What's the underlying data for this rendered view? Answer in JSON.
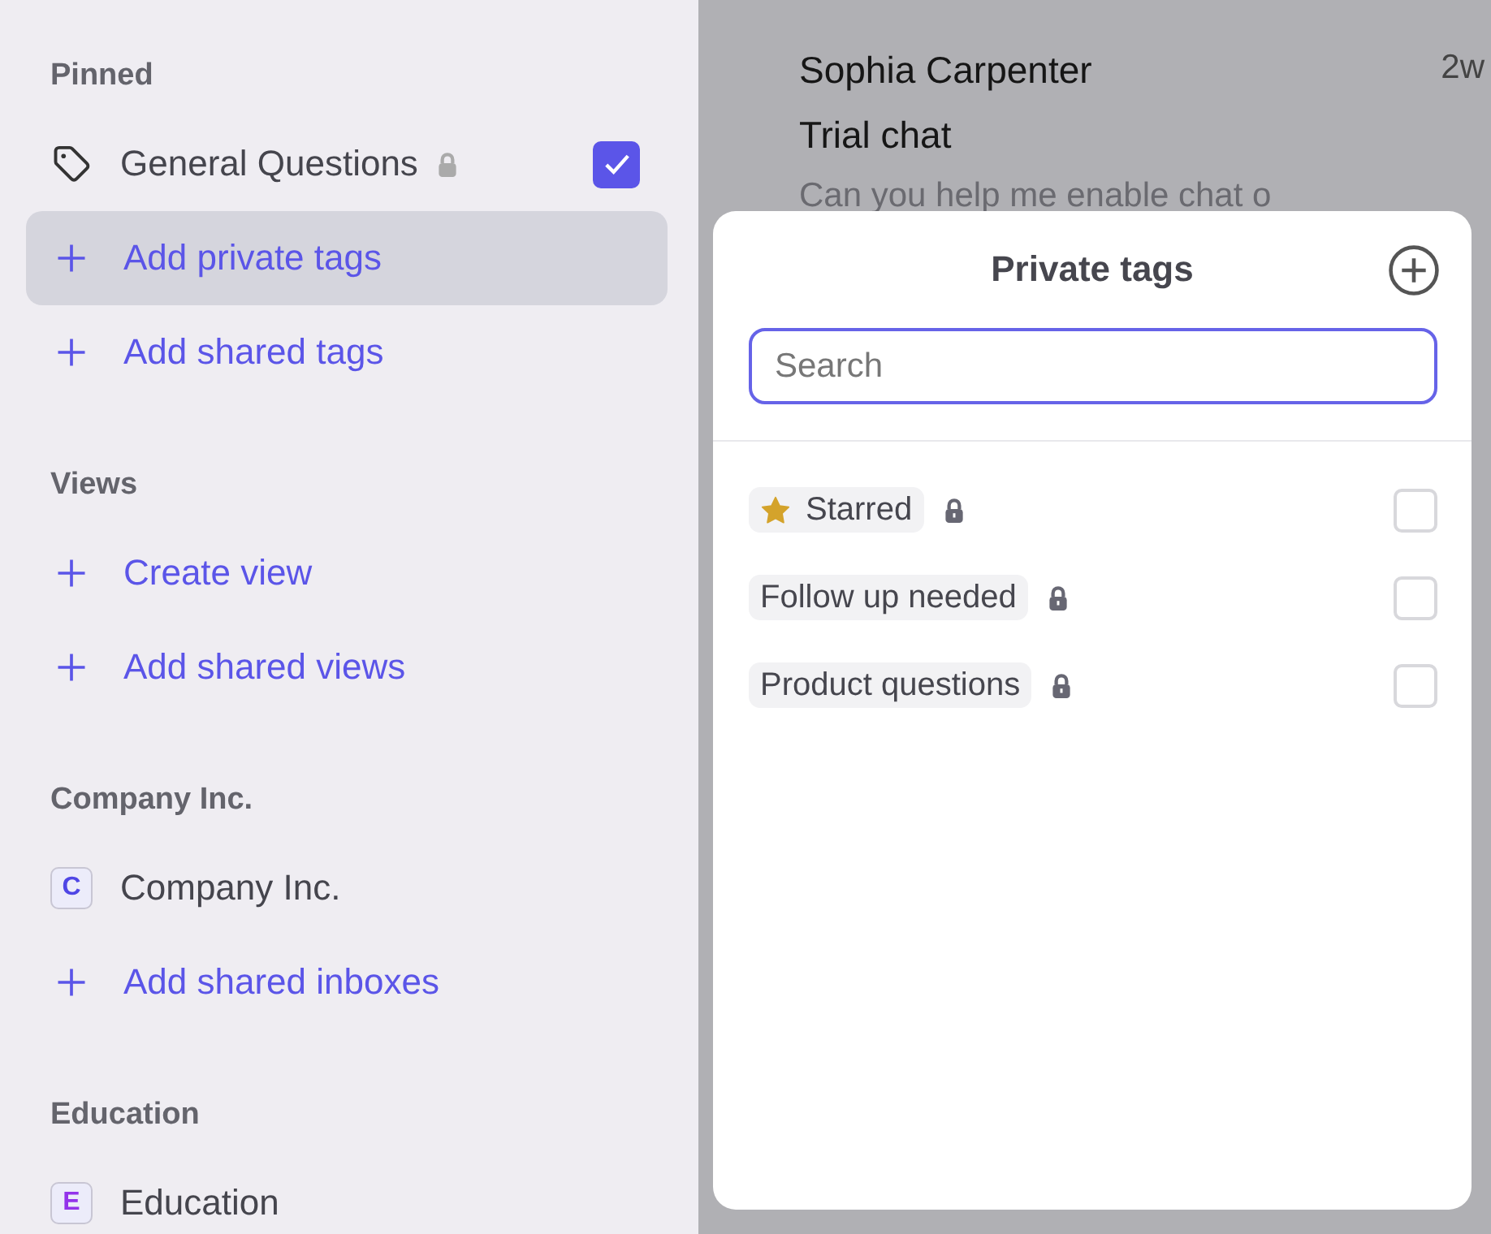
{
  "sidebar": {
    "sections": [
      {
        "title": "Pinned",
        "items": [
          {
            "kind": "tag",
            "label": "General Questions",
            "locked": true,
            "checked": true,
            "selected": false
          },
          {
            "kind": "add",
            "label": "Add private tags",
            "selected": true
          },
          {
            "kind": "add",
            "label": "Add shared tags",
            "selected": false
          }
        ]
      },
      {
        "title": "Views",
        "items": [
          {
            "kind": "add",
            "label": "Create view",
            "selected": false
          },
          {
            "kind": "add",
            "label": "Add shared views",
            "selected": false
          }
        ]
      },
      {
        "title": "Company Inc.",
        "items": [
          {
            "kind": "inbox",
            "letter": "C",
            "color": "#4f46e5",
            "label": "Company Inc.",
            "selected": false
          },
          {
            "kind": "add",
            "label": "Add shared inboxes",
            "selected": false
          }
        ]
      },
      {
        "title": "Education",
        "items": [
          {
            "kind": "inbox",
            "letter": "E",
            "color": "#9333ea",
            "label": "Education",
            "selected": false
          }
        ]
      }
    ]
  },
  "conversation": {
    "name": "Sophia Carpenter",
    "time": "2w",
    "subject": "Trial chat",
    "preview": "Can you help me enable chat o"
  },
  "popup": {
    "title": "Private tags",
    "search": {
      "placeholder": "Search"
    },
    "tags": [
      {
        "kind": "starred",
        "label": "Starred",
        "locked": true,
        "checked": false
      },
      {
        "kind": "plain",
        "label": "Follow up needed",
        "locked": true,
        "checked": false
      },
      {
        "kind": "plain",
        "label": "Product questions",
        "locked": true,
        "checked": false
      }
    ]
  }
}
